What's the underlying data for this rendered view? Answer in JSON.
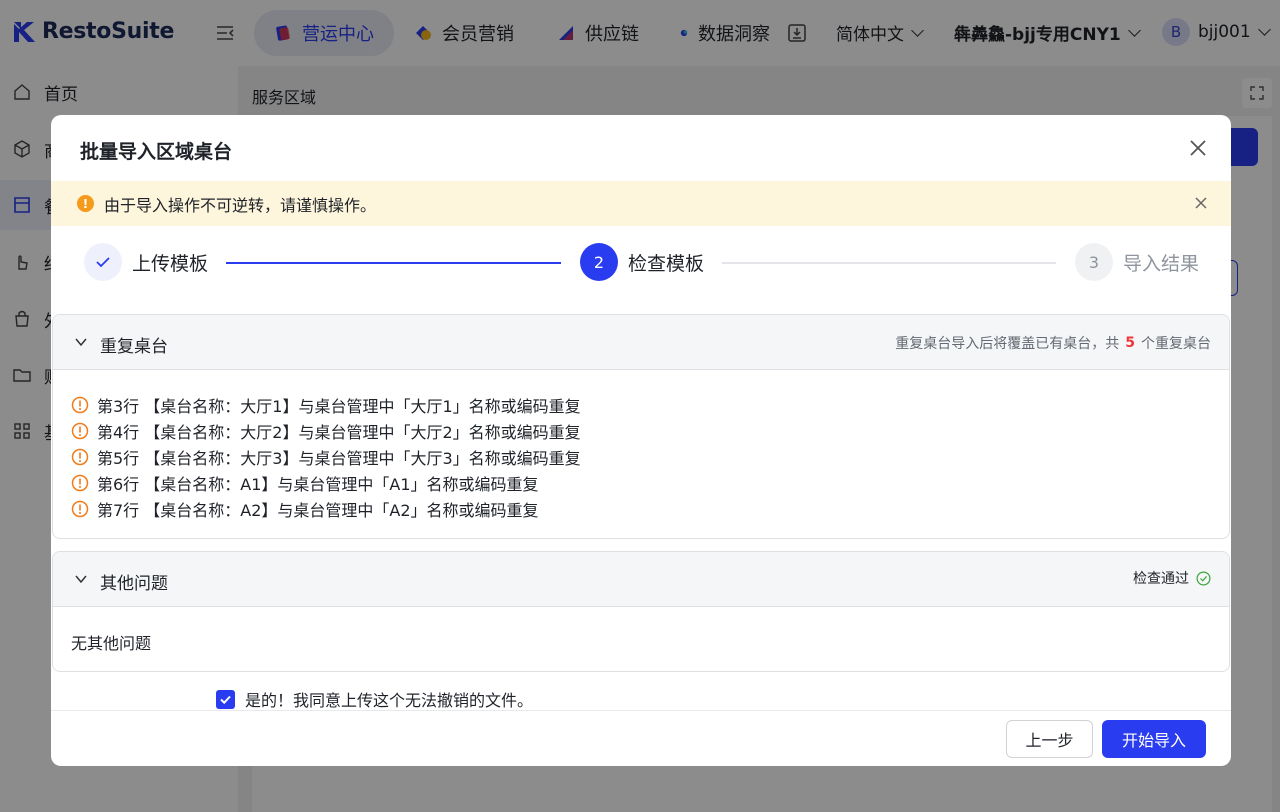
{
  "app": {
    "name": "RestoSuite"
  },
  "topnav": {
    "items": [
      {
        "label": "营运中心",
        "active": true
      },
      {
        "label": "会员营销"
      },
      {
        "label": "供应链"
      },
      {
        "label": "数据洞察"
      }
    ],
    "language": "简体中文",
    "store": "犇羴鱻-bjj专用CNY1",
    "user": {
      "avatar_letter": "B",
      "name": "bjj001"
    }
  },
  "sidebar": {
    "items": [
      {
        "label": "首页"
      },
      {
        "label": "商品"
      },
      {
        "label": "餐厅",
        "active": true
      },
      {
        "label": "结算"
      },
      {
        "label": "外卖"
      },
      {
        "label": "财务"
      },
      {
        "label": "基础"
      }
    ]
  },
  "page": {
    "breadcrumb": "服务区域"
  },
  "modal": {
    "title": "批量导入区域桌台",
    "alert": {
      "icon_text": "!",
      "text": "由于导入操作不可逆转，请谨慎操作。"
    },
    "steps": [
      {
        "label": "上传模板",
        "status": "done"
      },
      {
        "number": "2",
        "label": "检查模板",
        "status": "current"
      },
      {
        "number": "3",
        "label": "导入结果",
        "status": "pending"
      }
    ],
    "duplicates": {
      "title": "重复桌台",
      "summary_prefix": "重复桌台导入后将覆盖已有桌台，共",
      "count": "5",
      "summary_suffix": "个重复桌台",
      "items": [
        "第3行 【桌台名称：大厅1】与桌台管理中「大厅1」名称或编码重复",
        "第4行 【桌台名称：大厅2】与桌台管理中「大厅2」名称或编码重复",
        "第5行 【桌台名称：大厅3】与桌台管理中「大厅3」名称或编码重复",
        "第6行 【桌台名称：A1】与桌台管理中「A1」名称或编码重复",
        "第7行 【桌台名称：A2】与桌台管理中「A2」名称或编码重复"
      ]
    },
    "other": {
      "title": "其他问题",
      "status": "检查通过",
      "empty_text": "无其他问题"
    },
    "agree": {
      "checked": true,
      "label": "是的！我同意上传这个无法撤销的文件。"
    },
    "buttons": {
      "prev": "上一步",
      "start": "开始导入"
    }
  },
  "colors": {
    "primary": "#2a3cf0",
    "warning": "#f59a1b",
    "danger": "#f0353d",
    "success": "#3aa63a",
    "alert_bg": "#fdf5dc"
  }
}
